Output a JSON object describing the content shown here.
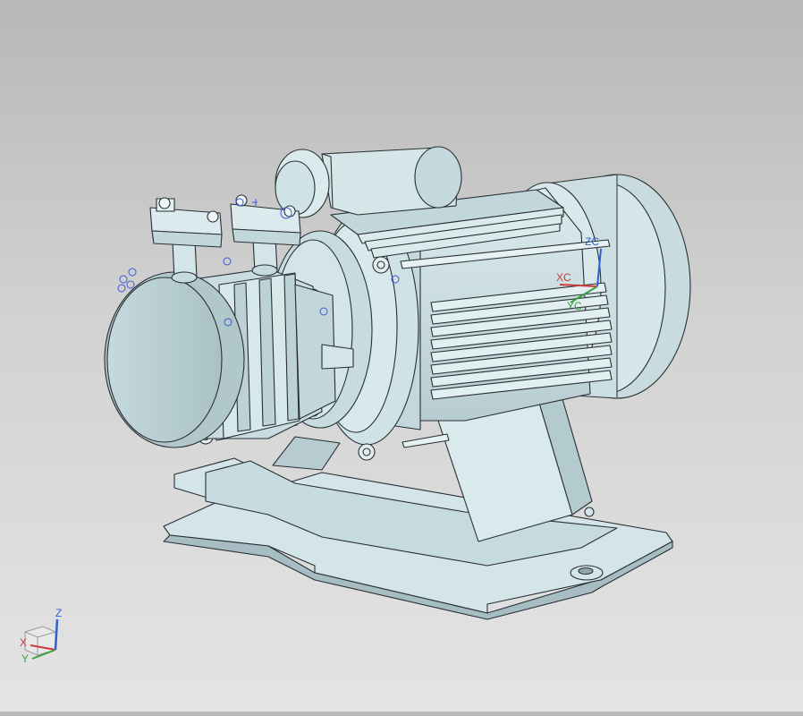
{
  "viewport": {
    "background_top": "#b8b8b8",
    "background_bottom": "#e4e4e4",
    "model_fill": "#cde0e4",
    "model_edge": "#2a2f33"
  },
  "wcs": {
    "zc_label": "ZC",
    "xc_label": "XC",
    "yc_label": "YC",
    "zc_color": "#2f5fd0",
    "xc_color": "#d03a3a",
    "yc_color": "#3aa040"
  },
  "view_triad": {
    "z_label": "Z",
    "x_label": "X",
    "y_label": "Y"
  }
}
